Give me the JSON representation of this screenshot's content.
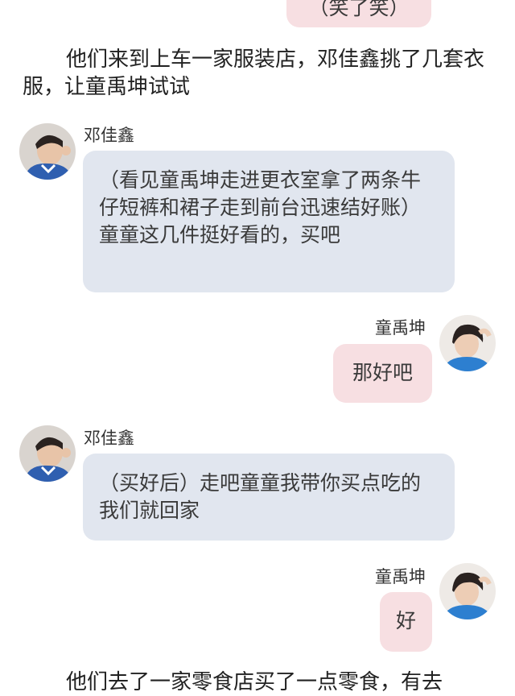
{
  "top_bubble": {
    "text": "（笑了笑）"
  },
  "narration_1": "他们来到上车一家服装店，邓佳鑫挑了几套衣服，让童禹坤试试",
  "messages": [
    {
      "sender": "邓佳鑫",
      "side": "left",
      "text": "（看见童禹坤走进更衣室拿了两条牛仔短裤和裙子走到前台迅速结好账）童童这几件挺好看的，买吧"
    },
    {
      "sender": "童禹坤",
      "side": "right",
      "text": "那好吧"
    },
    {
      "sender": "邓佳鑫",
      "side": "left",
      "text": "（买好后）走吧童童我带你买点吃的我们就回家"
    },
    {
      "sender": "童禹坤",
      "side": "right",
      "text": "好"
    }
  ],
  "narration_2": "他们去了一家零食店买了一点零食，有去",
  "colors": {
    "left_bubble": "#e1e6ef",
    "right_bubble": "#f7dfe2"
  }
}
